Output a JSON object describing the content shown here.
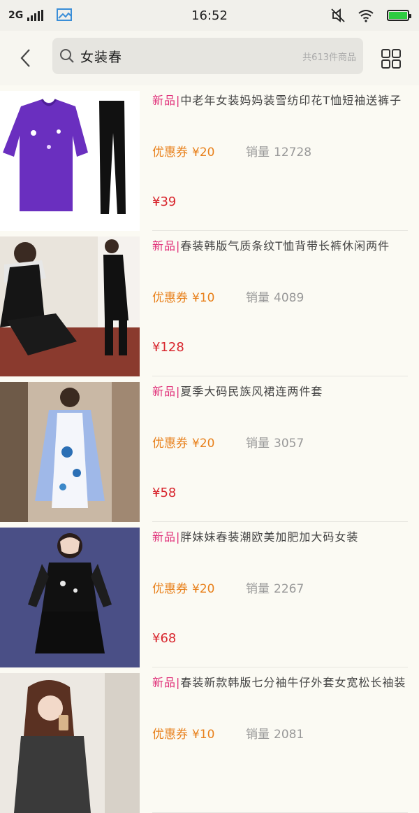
{
  "status_bar": {
    "network": "2G",
    "time": "16:52",
    "battery_level": 1.0
  },
  "search": {
    "query": "女装春",
    "result_count": "共613件商品"
  },
  "products": [
    {
      "tag": "新品|",
      "title": "中老年女装妈妈装雪纺印花T恤短袖送裤子",
      "coupon_label": "优惠券",
      "coupon_value": "¥20",
      "sales_label": "销量",
      "sales_value": "12728",
      "price": "¥39"
    },
    {
      "tag": "新品|",
      "title": "春装韩版气质条纹T恤背带长裤休闲两件",
      "coupon_label": "优惠券",
      "coupon_value": "¥10",
      "sales_label": "销量",
      "sales_value": "4089",
      "price": "¥128"
    },
    {
      "tag": "新品|",
      "title": "夏季大码民族风裙连两件套",
      "coupon_label": "优惠券",
      "coupon_value": "¥20",
      "sales_label": "销量",
      "sales_value": "3057",
      "price": "¥58"
    },
    {
      "tag": "新品|",
      "title": "胖妹妹春装潮欧美加肥加大码女装",
      "coupon_label": "优惠券",
      "coupon_value": "¥20",
      "sales_label": "销量",
      "sales_value": "2267",
      "price": "¥68"
    },
    {
      "tag": "新品|",
      "title": "春装新款韩版七分袖牛仔外套女宽松长袖装",
      "coupon_label": "优惠券",
      "coupon_value": "¥10",
      "sales_label": "销量",
      "sales_value": "2081",
      "price": ""
    }
  ]
}
